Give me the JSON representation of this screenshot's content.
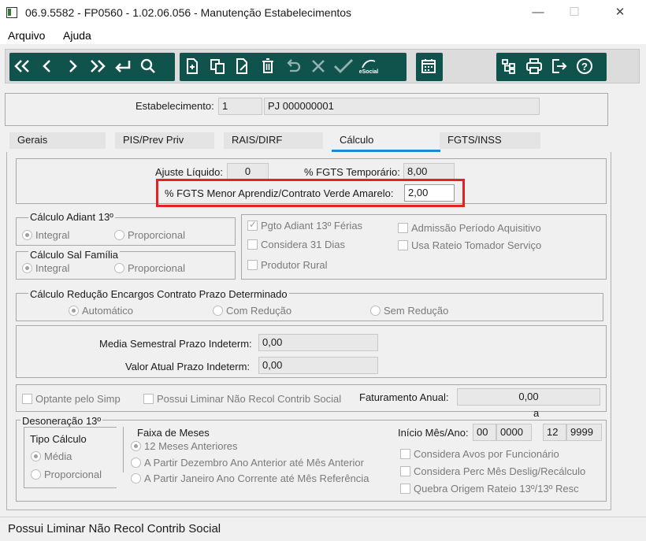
{
  "window": {
    "title": "06.9.5582 - FP0560 - 1.02.06.056 - Manutenção Estabelecimentos",
    "minimize": "—",
    "maximize": "☐",
    "close": "✕"
  },
  "menu": {
    "arquivo": "Arquivo",
    "ajuda": "Ajuda"
  },
  "header": {
    "estab_label": "Estabelecimento:",
    "estab_code": "1",
    "estab_name": "PJ 000000001"
  },
  "tabs": [
    "Gerais",
    "PIS/Prev Priv",
    "RAIS/DIRF",
    "Cálculo",
    "FGTS/INSS"
  ],
  "top": {
    "ajuste_label": "Ajuste Líquido:",
    "ajuste_value": "0",
    "fgts_temp_label": "% FGTS Temporário:",
    "fgts_temp_value": "8,00",
    "fgts_menor_label": "% FGTS Menor Aprendiz/Contrato Verde Amarelo:",
    "fgts_menor_value": "2,00"
  },
  "adiant": {
    "title": "Cálculo Adiant 13º",
    "integral": "Integral",
    "proporcional": "Proporcional"
  },
  "salfam": {
    "title": "Cálculo Sal Família",
    "integral": "Integral",
    "proporcional": "Proporcional"
  },
  "checks_right": {
    "pgto": "Pgto Adiant 13º Férias",
    "considera31": "Considera 31 Dias",
    "produtor": "Produtor Rural",
    "admissao": "Admissão Período Aquisitivo",
    "rateio": "Usa Rateio Tomador Serviço"
  },
  "reducao": {
    "title": "Cálculo Redução Encargos Contrato Prazo Determinado",
    "automatico": "Automático",
    "com": "Com Redução",
    "sem": "Sem Redução"
  },
  "media": {
    "media_label": "Media Semestral Prazo Indeterm:",
    "media_value": "0,00",
    "valor_label": "Valor Atual Prazo Indeterm:",
    "valor_value": "0,00"
  },
  "simp": {
    "optante": "Optante pelo Simp",
    "liminar": "Possui Liminar Não Recol Contrib Social",
    "fat_label": "Faturamento Anual:",
    "fat_value": "0,00"
  },
  "deson": {
    "title": "Desoneração 13º",
    "tipo_title": "Tipo Cálculo",
    "media": "Média",
    "proporcional": "Proporcional",
    "faixa_title": "Faixa de Meses",
    "meses12": "12 Meses Anteriores",
    "dezembro": "A Partir Dezembro Ano Anterior até Mês Anterior",
    "janeiro": "A Partir Janeiro Ano Corrente até Mês Referência",
    "inicio_label": "Início Mês/Ano:",
    "ini_mes": "00",
    "ini_ano": "0000",
    "a_label": "a",
    "fim_mes": "12",
    "fim_ano": "9999",
    "avos": "Considera Avos por Funcionário",
    "perc": "Considera Perc Mês Deslig/Recálculo",
    "quebra": "Quebra Origem Rateio 13º/13º Resc"
  },
  "status": {
    "text": "Possui Liminar Não Recol Contrib Social"
  },
  "colors": {
    "toolbar_button": "#10534d",
    "highlight": "#e32222",
    "tab_accent": "#1a8ad4"
  },
  "toolbar_icons": [
    "first-icon",
    "prev-icon",
    "next-icon",
    "last-icon",
    "return-icon",
    "search-icon",
    "new-icon",
    "copy-icon",
    "edit-icon",
    "delete-icon",
    "undo-icon",
    "cancel-icon",
    "confirm-icon",
    "esocial-icon",
    "calendar-icon",
    "tree-icon",
    "print-icon",
    "exit-icon",
    "help-icon"
  ],
  "toolbar_text": {
    "esocial": "eSocial"
  }
}
